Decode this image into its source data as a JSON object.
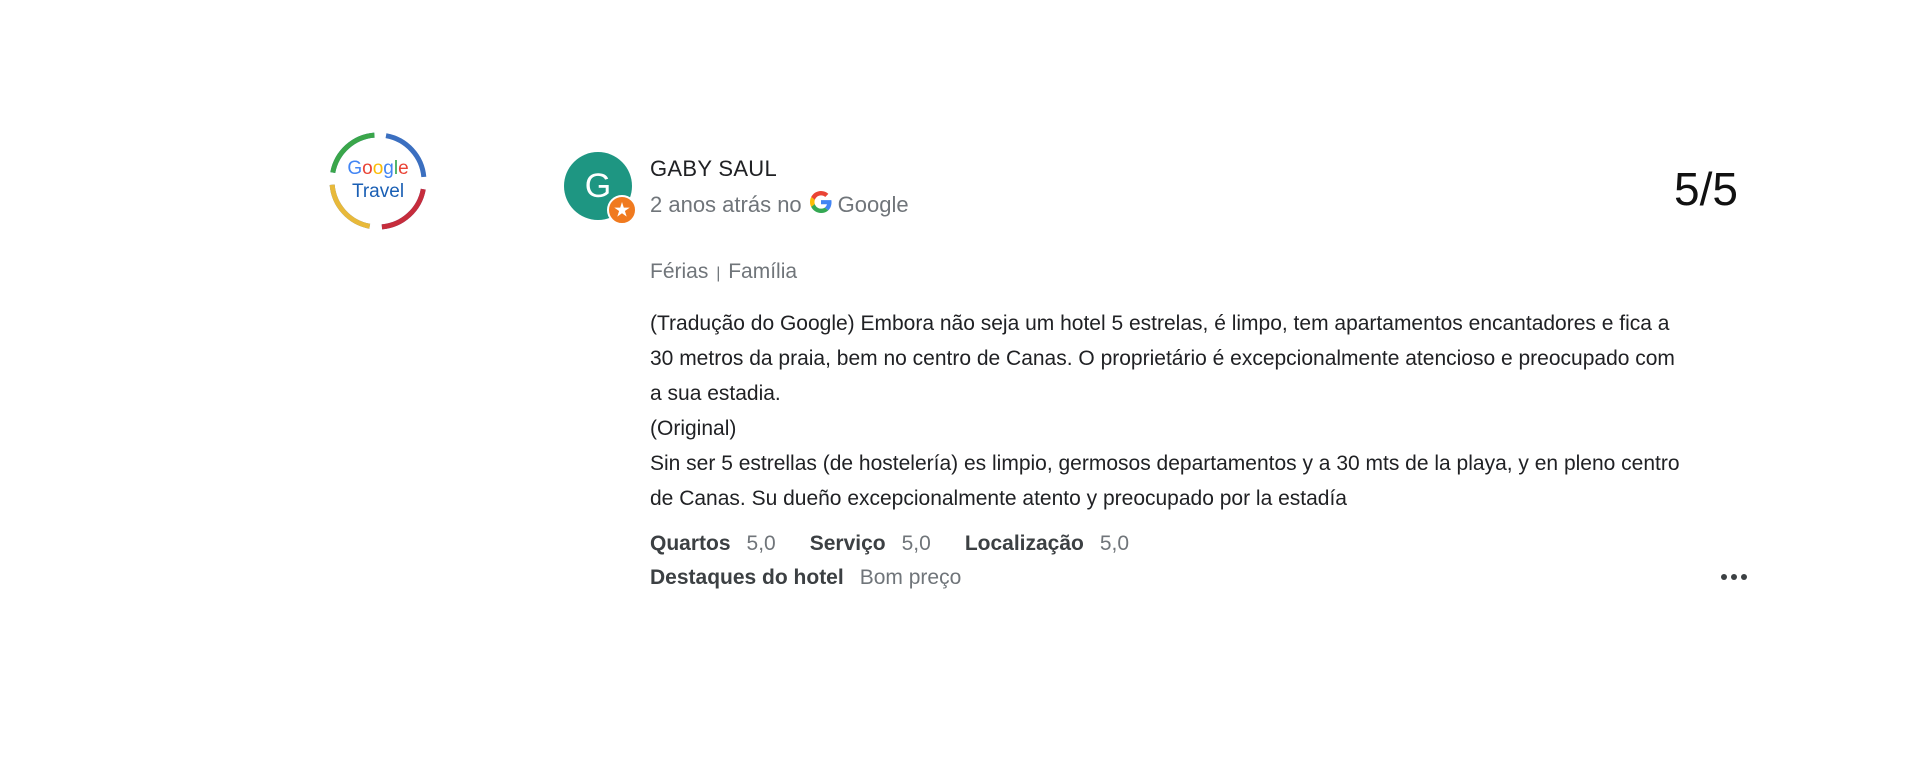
{
  "logo": {
    "line1": [
      "G",
      "o",
      "o",
      "g",
      "l",
      "e"
    ],
    "line2": "Travel"
  },
  "reviewer": {
    "avatar_letter": "G",
    "name": "GABY SAUL",
    "time_ago": "2 anos atrás no",
    "source": "Google"
  },
  "score": "5/5",
  "trip": {
    "type": "Férias",
    "separator": "|",
    "group": "Família"
  },
  "review": {
    "translated": "(Tradução do Google) Embora não seja um hotel 5 estrelas, é limpo, tem apartamentos encantadores e fica a 30 metros da praia, bem no centro de Canas. O proprietário é excepcionalmente atencioso e preocupado com a sua estadia.",
    "original_label": "(Original)",
    "original": "Sin ser 5 estrellas (de hostelería) es limpio, germosos departamentos y a 30 mts de la playa, y en pleno centro de Canas. Su dueño excepcionalmente atento y preocupado por la estadía"
  },
  "ratings": [
    {
      "label": "Quartos",
      "value": "5,0"
    },
    {
      "label": "Serviço",
      "value": "5,0"
    },
    {
      "label": "Localização",
      "value": "5,0"
    }
  ],
  "highlights": {
    "label": "Destaques do hotel",
    "value": "Bom preço"
  },
  "icons": {
    "avatar_badge": "local-guide-badge-icon",
    "source_logo": "google-g-icon",
    "menu": "more-options-icon"
  },
  "colors": {
    "avatar": "#1e9682",
    "badge": "#f07a1f",
    "google_blue": "#4285F4",
    "google_red": "#EA4335",
    "google_yellow": "#FBBC05",
    "google_green": "#34A853"
  }
}
